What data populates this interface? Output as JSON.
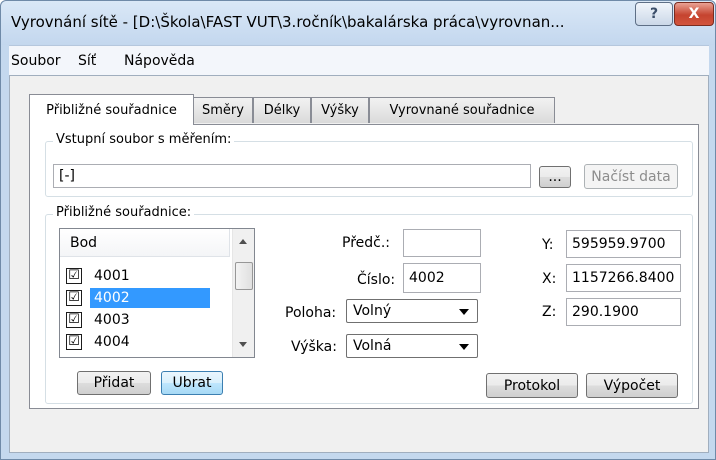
{
  "window": {
    "title": "Vyrovnání sítě - [D:\\Škola\\FAST VUT\\3.ročník\\bakalárska práca\\vyrovnan...",
    "help_label": "?",
    "close_label": "X"
  },
  "menu": {
    "items": [
      {
        "label": "Soubor"
      },
      {
        "label": "Síť"
      },
      {
        "label": "Nápověda"
      }
    ]
  },
  "tabs": [
    {
      "label": "Přibližné souřadnice",
      "active": true
    },
    {
      "label": "Směry"
    },
    {
      "label": "Délky"
    },
    {
      "label": "Výšky"
    },
    {
      "label": "Vyrovnané souřadnice"
    }
  ],
  "input_group": {
    "label": "Vstupní soubor s měřením:",
    "file_value": "[-]",
    "browse_label": "...",
    "load_label": "Načíst data"
  },
  "coords_group": {
    "label": "Přibližné souřadnice:",
    "list": {
      "header": "Bod",
      "rows": [
        {
          "label": "4001",
          "checked": "☑"
        },
        {
          "label": "4002",
          "checked": "☑",
          "selected": true
        },
        {
          "label": "4003",
          "checked": "☑"
        },
        {
          "label": "4004",
          "checked": "☑"
        }
      ]
    },
    "add_label": "Přidat",
    "remove_label": "Ubrat",
    "fields": {
      "pred_label": "Předč.:",
      "pred_value": "",
      "cislo_label": "Číslo:",
      "cislo_value": "4002",
      "poloha_label": "Poloha:",
      "poloha_value": "Volný",
      "vyska_label": "Výška:",
      "vyska_value": "Volná",
      "y_label": "Y:",
      "y_value": "595959.9700",
      "x_label": "X:",
      "x_value": "1157266.8400",
      "z_label": "Z:",
      "z_value": "290.1900"
    },
    "protokol_label": "Protokol",
    "vypocet_label": "Výpočet"
  }
}
